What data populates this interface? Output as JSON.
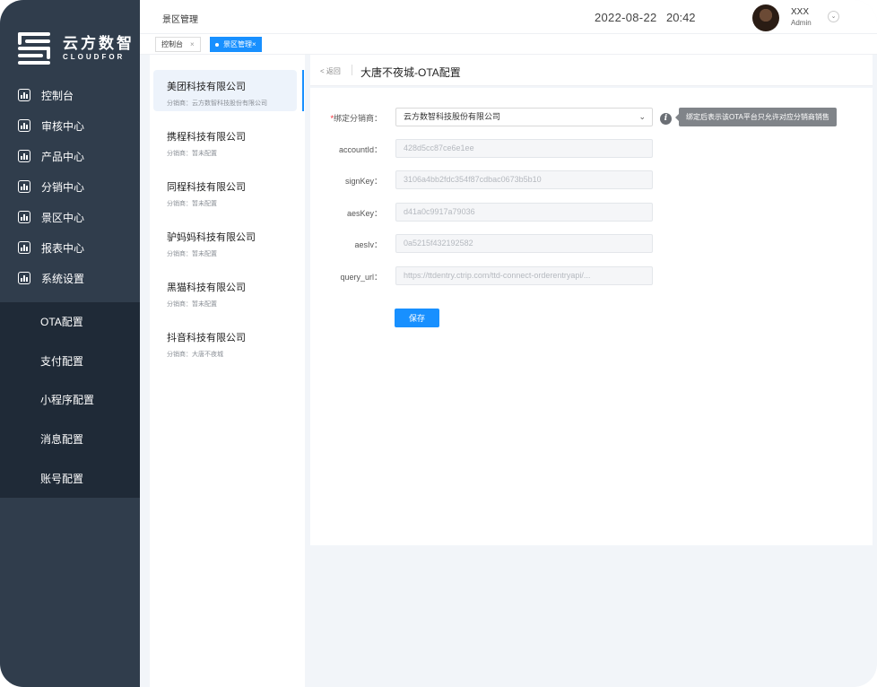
{
  "brand": {
    "name_cn": "云方数智",
    "name_en": "CLOUDFOR"
  },
  "sidebar": {
    "items": [
      {
        "label": "控制台",
        "icon": "chart-icon"
      },
      {
        "label": "审核中心",
        "icon": "chart-icon"
      },
      {
        "label": "产品中心",
        "icon": "chart-icon"
      },
      {
        "label": "分销中心",
        "icon": "chart-icon"
      },
      {
        "label": "景区中心",
        "icon": "chart-icon"
      },
      {
        "label": "报表中心",
        "icon": "chart-icon"
      },
      {
        "label": "系统设置",
        "icon": "chart-icon"
      }
    ],
    "subitems": [
      {
        "label": "OTA配置"
      },
      {
        "label": "支付配置"
      },
      {
        "label": "小程序配置"
      },
      {
        "label": "消息配置"
      },
      {
        "label": "账号配置"
      }
    ]
  },
  "header": {
    "title": "景区管理",
    "date": "2022-08-22",
    "time": "20:42",
    "user_name": "XXX",
    "user_role": "Admin"
  },
  "tabs": [
    {
      "label": "控制台",
      "close": "×"
    },
    {
      "label": "景区管理",
      "close": "×"
    }
  ],
  "companies": [
    {
      "name": "美团科技有限公司",
      "sub": "分销商：云方数智科技股份有限公司"
    },
    {
      "name": "携程科技有限公司",
      "sub": "分销商：暂未配置"
    },
    {
      "name": "同程科技有限公司",
      "sub": "分销商：暂未配置"
    },
    {
      "name": "驴妈妈科技有限公司",
      "sub": "分销商：暂未配置"
    },
    {
      "name": "黑猫科技有限公司",
      "sub": "分销商：暂未配置"
    },
    {
      "name": "抖音科技有限公司",
      "sub": "分销商：大唐不夜城"
    }
  ],
  "page": {
    "back": "< 返回",
    "title": "大唐不夜城-OTA配置"
  },
  "form": {
    "distributor_label": "绑定分销商：",
    "distributor_value": "云方数智科技股份有限公司",
    "distributor_hint": "绑定后表示该OTA平台只允许对应分销商销售",
    "fields": [
      {
        "label": "accountId：",
        "value": "428d5cc87ce6e1ee"
      },
      {
        "label": "signKey：",
        "value": "3106a4bb2fdc354f87cdbac0673b5b10"
      },
      {
        "label": "aesKey：",
        "value": "d41a0c9917a79036"
      },
      {
        "label": "aesIv：",
        "value": "0a5215f432192582"
      },
      {
        "label": "query_url：",
        "value": "https://ttdentry.ctrip.com/ttd-connect-orderentryapi/..."
      }
    ],
    "save_label": "保存"
  },
  "colors": {
    "sidebar_bg": "#303d4c",
    "submenu_bg": "#1f2a37",
    "accent": "#1890ff",
    "required": "#f5222d"
  }
}
